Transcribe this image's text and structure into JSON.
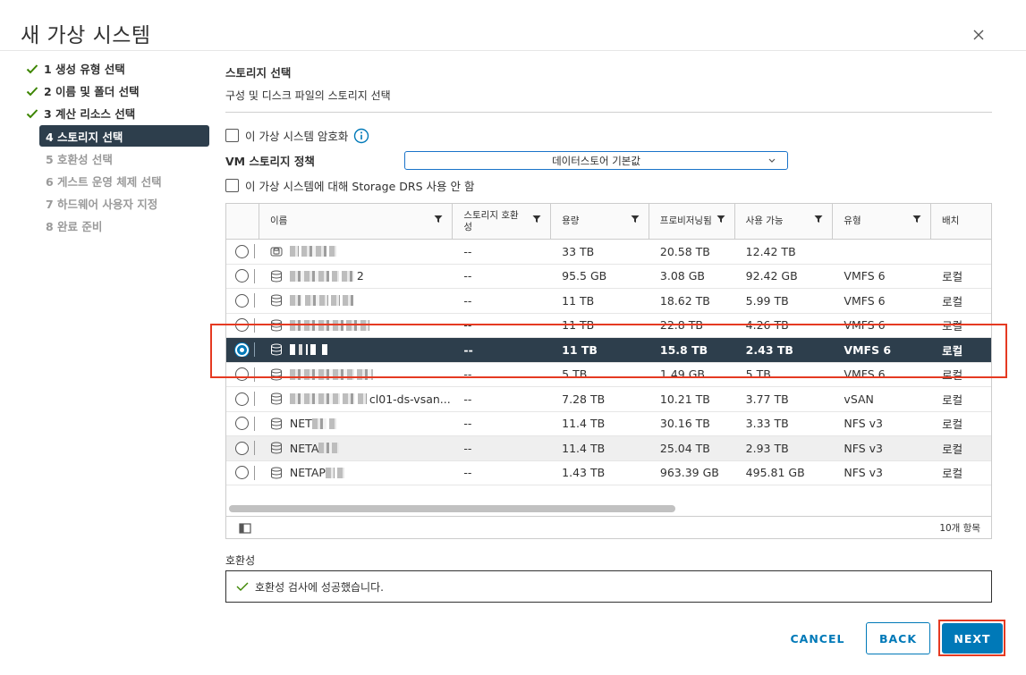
{
  "dialog": {
    "title": "새 가상 시스템"
  },
  "colors": {
    "accent": "#0079b8",
    "selected_row": "#2d3e4c",
    "check_green": "#3c8500",
    "highlight": "#e53a22"
  },
  "steps": [
    {
      "label": "1 생성 유형 선택",
      "state": "done"
    },
    {
      "label": "2 이름 및 폴더 선택",
      "state": "done"
    },
    {
      "label": "3 계산 리소스 선택",
      "state": "done"
    },
    {
      "label": "4 스토리지 선택",
      "state": "active"
    },
    {
      "label": "5 호환성 선택",
      "state": "future"
    },
    {
      "label": "6 게스트 운영 체제 선택",
      "state": "future"
    },
    {
      "label": "7 하드웨어 사용자 지정",
      "state": "future"
    },
    {
      "label": "8 완료 준비",
      "state": "future"
    }
  ],
  "section": {
    "title": "스토리지 선택",
    "subtitle": "구성 및 디스크 파일의 스토리지 선택"
  },
  "options": {
    "encrypt_label": "이 가상 시스템 암호화",
    "policy_label": "VM 스토리지 정책",
    "policy_value": "데이터스토어 기본값",
    "drs_label": "이 가상 시스템에 대해 Storage DRS 사용 안 함"
  },
  "table": {
    "columns": [
      "이름",
      "스토리지 호환성",
      "용량",
      "프로비저닝됨",
      "사용 가능",
      "유형",
      "배치"
    ],
    "rows": [
      {
        "name_suffix": "",
        "compat": "--",
        "capacity": "33 TB",
        "provisioned": "20.58 TB",
        "free": "12.42 TB",
        "type": "",
        "placement": "",
        "icon": "datastore-cluster-icon"
      },
      {
        "name_suffix": "2",
        "compat": "--",
        "capacity": "95.5 GB",
        "provisioned": "3.08 GB",
        "free": "92.42 GB",
        "type": "VMFS 6",
        "placement": "로컬",
        "icon": "datastore-icon"
      },
      {
        "name_suffix": "",
        "compat": "--",
        "capacity": "11 TB",
        "provisioned": "18.62 TB",
        "free": "5.99 TB",
        "type": "VMFS 6",
        "placement": "로컬",
        "icon": "datastore-icon"
      },
      {
        "name_suffix": "",
        "compat": "--",
        "capacity": "11 TB",
        "provisioned": "22.8 TB",
        "free": "4.26 TB",
        "type": "VMFS 6",
        "placement": "로컬",
        "icon": "datastore-icon"
      },
      {
        "name_suffix": "",
        "compat": "--",
        "capacity": "11 TB",
        "provisioned": "15.8 TB",
        "free": "2.43 TB",
        "type": "VMFS 6",
        "placement": "로컬",
        "icon": "datastore-icon",
        "selected": true
      },
      {
        "name_suffix": "",
        "compat": "--",
        "capacity": "5 TB",
        "provisioned": "1.49 GB",
        "free": "5 TB",
        "type": "VMFS 6",
        "placement": "로컬",
        "icon": "datastore-icon"
      },
      {
        "name_suffix": "cl01-ds-vsan...",
        "compat": "--",
        "capacity": "7.28 TB",
        "provisioned": "10.21 TB",
        "free": "3.77 TB",
        "type": "vSAN",
        "placement": "로컬",
        "icon": "datastore-icon"
      },
      {
        "name_prefix": "NET",
        "name_suffix": "",
        "compat": "--",
        "capacity": "11.4 TB",
        "provisioned": "30.16 TB",
        "free": "3.33 TB",
        "type": "NFS v3",
        "placement": "로컬",
        "icon": "datastore-icon"
      },
      {
        "name_prefix": "NETA",
        "name_suffix": "",
        "compat": "--",
        "capacity": "11.4 TB",
        "provisioned": "25.04 TB",
        "free": "2.93 TB",
        "type": "NFS v3",
        "placement": "로컬",
        "icon": "datastore-icon"
      },
      {
        "name_prefix": "NETAP",
        "name_suffix": "",
        "compat": "--",
        "capacity": "1.43 TB",
        "provisioned": "963.39 GB",
        "free": "495.81 GB",
        "type": "NFS v3",
        "placement": "로컬",
        "icon": "datastore-icon"
      }
    ],
    "footer_count": "10개 항목"
  },
  "compat": {
    "label": "호환성",
    "message": "호환성 검사에 성공했습니다."
  },
  "buttons": {
    "cancel": "CANCEL",
    "back": "BACK",
    "next": "NEXT"
  }
}
